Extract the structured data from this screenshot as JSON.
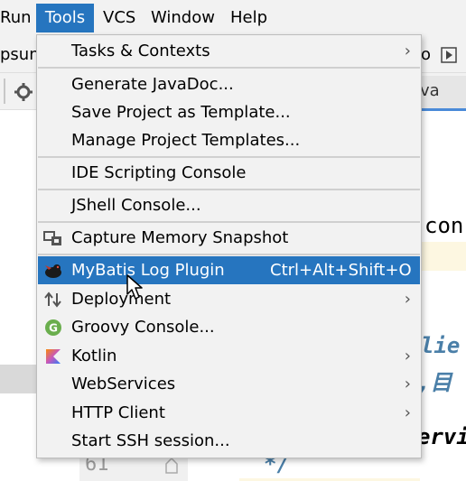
{
  "menubar": {
    "items": [
      {
        "label": "Run"
      },
      {
        "label": "Tools"
      },
      {
        "label": "VCS"
      },
      {
        "label": "Window"
      },
      {
        "label": "Help"
      }
    ]
  },
  "background": {
    "toolbar_left_text": "psun",
    "toolbar_right_text": "o",
    "tab_text": "ava",
    "code_con": "con",
    "code_clie": "lie",
    "code_cn": ",目",
    "code_servi": "ervi",
    "code_comment_end": "*/",
    "line_number": "61"
  },
  "tools_menu": {
    "items": [
      {
        "label": "Tasks & Contexts",
        "has_submenu": true
      },
      {
        "label": "Generate JavaDoc..."
      },
      {
        "label": "Save Project as Template..."
      },
      {
        "label": "Manage Project Templates..."
      },
      {
        "label": "IDE Scripting Console"
      },
      {
        "label": "JShell Console..."
      },
      {
        "label": "Capture Memory Snapshot",
        "icon": "memory-snapshot-icon"
      },
      {
        "label": "MyBatis Log Plugin",
        "shortcut": "Ctrl+Alt+Shift+O",
        "icon": "mybatis-bird-icon",
        "selected": true
      },
      {
        "label": "Deployment",
        "has_submenu": true,
        "icon": "deployment-arrows-icon"
      },
      {
        "label": "Groovy Console...",
        "icon": "groovy-icon"
      },
      {
        "label": "Kotlin",
        "has_submenu": true,
        "icon": "kotlin-icon"
      },
      {
        "label": "WebServices",
        "has_submenu": true
      },
      {
        "label": "HTTP Client",
        "has_submenu": true
      },
      {
        "label": "Start SSH session..."
      }
    ]
  },
  "colors": {
    "selection": "#2675bf",
    "menu_bg": "#f2f2f2",
    "code_blue_italic": "#4a7fa8",
    "groovy_green": "#6aae4d"
  }
}
